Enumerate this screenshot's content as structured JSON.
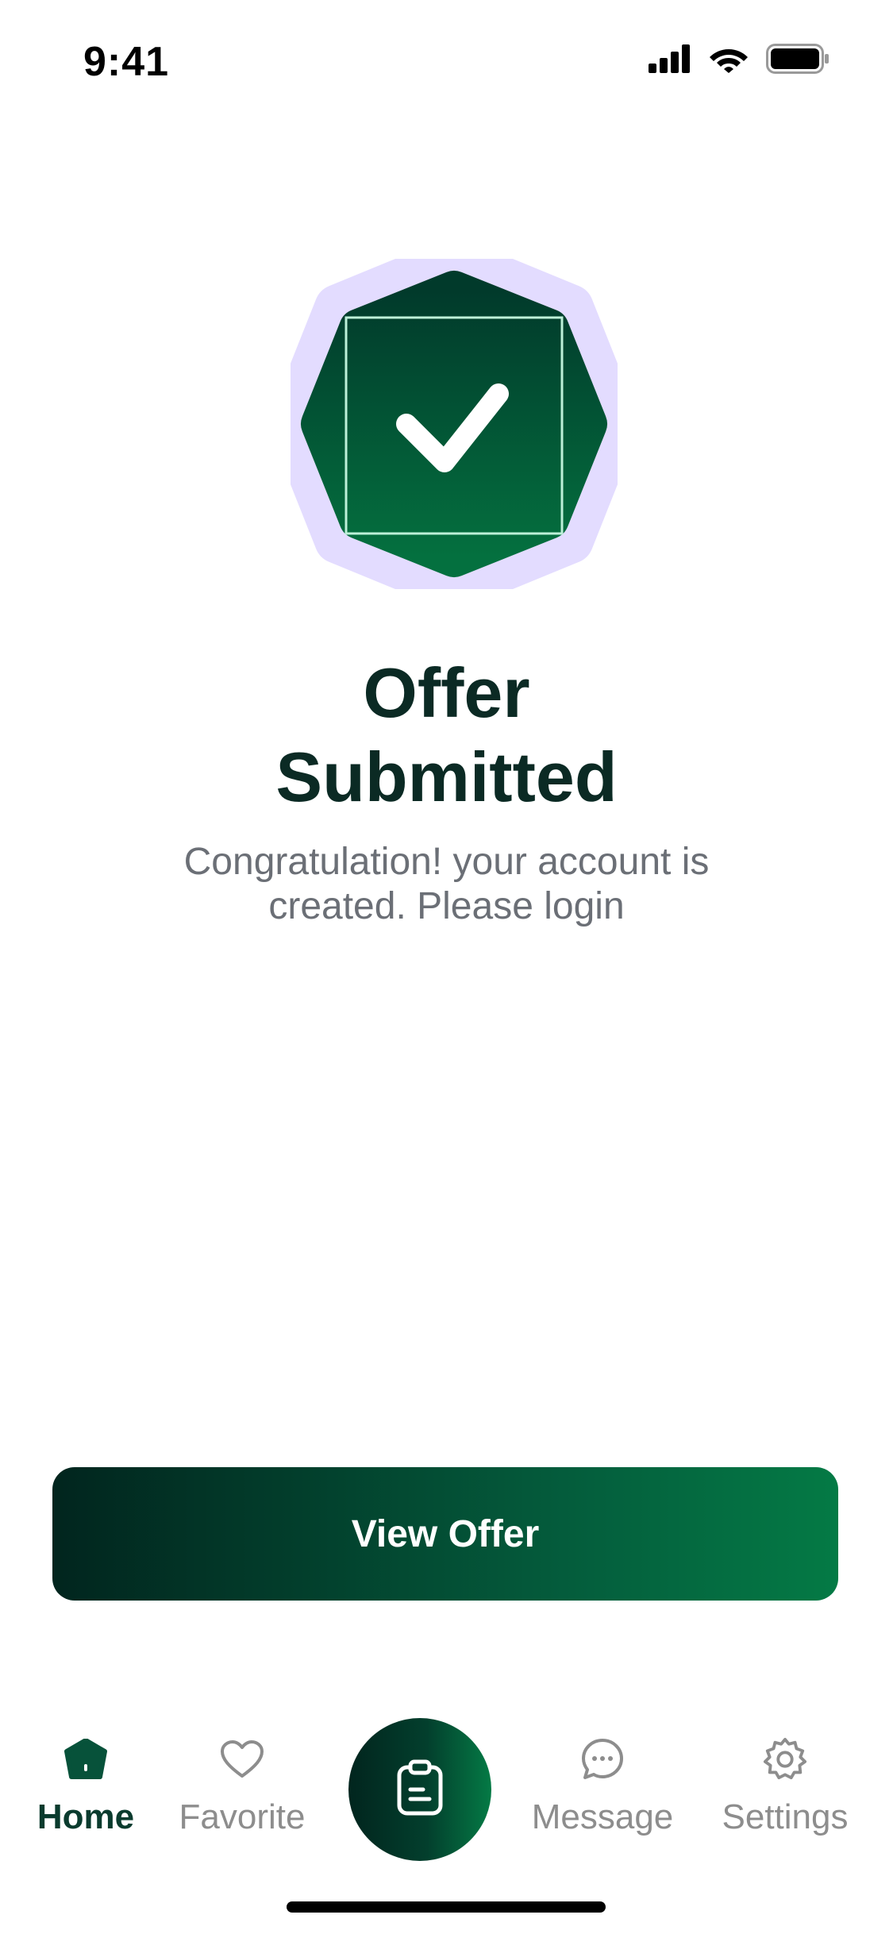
{
  "status_bar": {
    "time": "9:41"
  },
  "icons": {
    "signal": "cellular-signal-icon",
    "wifi": "wifi-icon",
    "battery": "battery-icon",
    "badge": "check-badge-icon",
    "home": "home-icon",
    "favorite": "heart-icon",
    "center": "clipboard-icon",
    "message": "chat-bubble-icon",
    "settings": "gear-icon"
  },
  "confirmation": {
    "title_line1": "Offer",
    "title_line2": "Submitted",
    "subtitle_line1": "Congratulation! your account is",
    "subtitle_line2": "created. Please login"
  },
  "cta": {
    "label": "View Offer"
  },
  "bottom_nav": {
    "items": [
      {
        "label": "Home",
        "active": true
      },
      {
        "label": "Favorite",
        "active": false
      },
      {
        "label": "Message",
        "active": false
      },
      {
        "label": "Settings",
        "active": false
      }
    ]
  },
  "colors": {
    "brand_dark": "#01251e",
    "brand_green": "#047a45",
    "badge_halo": "#e3dcff",
    "title_text": "#0b2a24",
    "subtitle_text": "#6b6f76",
    "nav_inactive": "#8d8d8d"
  }
}
